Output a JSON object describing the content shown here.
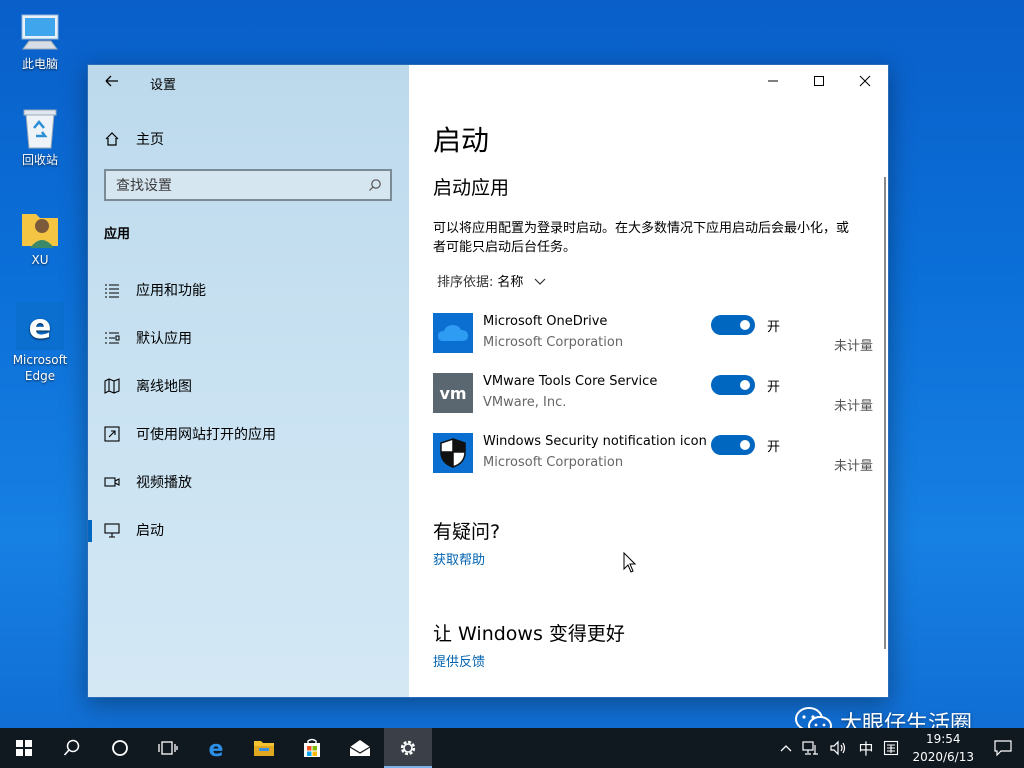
{
  "desktop": {
    "icons": [
      {
        "label": "此电脑",
        "icon": "computer-icon"
      },
      {
        "label": "回收站",
        "icon": "recycle-bin-icon"
      },
      {
        "label": "XU",
        "icon": "user-folder-icon"
      },
      {
        "label": "Microsoft Edge",
        "icon": "edge-shortcut-icon"
      }
    ]
  },
  "window": {
    "title": "设置",
    "caption": {
      "minimize": "minimize-icon",
      "maximize": "maximize-icon",
      "close": "close-icon"
    }
  },
  "sidebar": {
    "home_label": "主页",
    "search_placeholder": "查找设置",
    "section_label": "应用",
    "items": [
      {
        "label": "应用和功能",
        "icon": "apps-features-icon"
      },
      {
        "label": "默认应用",
        "icon": "default-apps-icon"
      },
      {
        "label": "离线地图",
        "icon": "offline-maps-icon"
      },
      {
        "label": "可使用网站打开的应用",
        "icon": "apps-for-websites-icon"
      },
      {
        "label": "视频播放",
        "icon": "video-playback-icon"
      },
      {
        "label": "启动",
        "icon": "startup-icon",
        "active": true
      }
    ]
  },
  "main": {
    "page_title": "启动",
    "subtitle": "启动应用",
    "description": "可以将应用配置为登录时启动。在大多数情况下应用启动后会最小化，或者可能只启动后台任务。",
    "sort_label": "排序依据:",
    "sort_value": "名称",
    "apps": [
      {
        "name": "Microsoft OneDrive",
        "publisher": "Microsoft Corporation",
        "state": "开",
        "impact": "未计量",
        "on": true,
        "icon": "onedrive-icon"
      },
      {
        "name": "VMware Tools Core Service",
        "publisher": "VMware, Inc.",
        "state": "开",
        "impact": "未计量",
        "on": true,
        "icon": "vmware-icon"
      },
      {
        "name": "Windows Security notification icon",
        "publisher": "Microsoft Corporation",
        "state": "开",
        "impact": "未计量",
        "on": true,
        "icon": "windows-security-icon"
      }
    ],
    "question_title": "有疑问?",
    "help_link": "获取帮助",
    "improve_title": "让 Windows 变得更好",
    "feedback_link": "提供反馈"
  },
  "watermark": "大眼仔生活圈",
  "taskbar": {
    "items": [
      "start-icon",
      "search-icon",
      "cortana-icon",
      "task-view-icon",
      "edge-icon",
      "file-explorer-icon",
      "store-icon",
      "mail-icon",
      "settings-icon"
    ],
    "tray": {
      "ime": "中",
      "time": "19:54",
      "date": "2020/6/13"
    }
  }
}
